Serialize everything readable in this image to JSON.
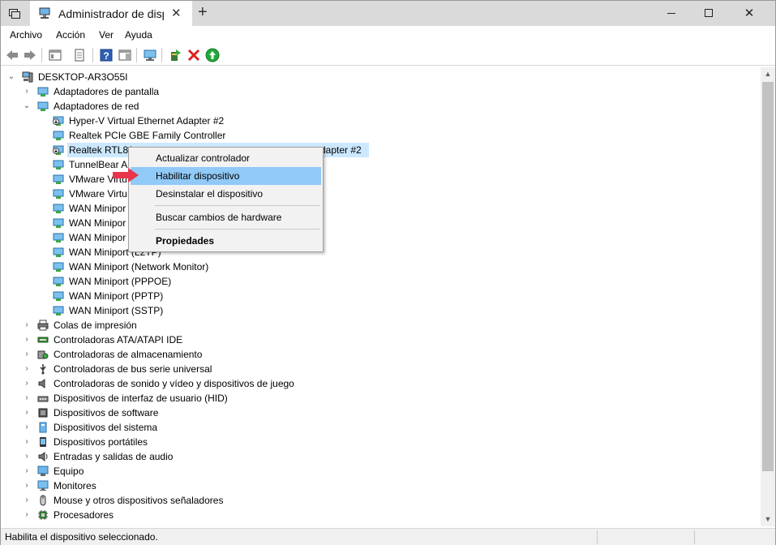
{
  "title_bar": {
    "tab_title": "Administrador de dispositivos",
    "close_tab": "✕",
    "new_tab": "+",
    "minimize_icon": "minimize-icon",
    "maximize_icon": "maximize-icon",
    "close_icon": "✕"
  },
  "menu": {
    "items": [
      "Archivo",
      "Acción",
      "Ver",
      "Ayuda"
    ]
  },
  "tree": {
    "root": "DESKTOP-AR3O55I",
    "display_adapters": "Adaptadores de pantalla",
    "network_adapters": "Adaptadores de red",
    "network_children": [
      "Hyper-V Virtual Ethernet Adapter #2",
      "Realtek PCIe GBE Family Controller",
      "Realtek RTL81",
      "TunnelBear A",
      "VMware Virtu",
      "VMware Virtu",
      "WAN Minipor",
      "WAN Minipor",
      "WAN Minipor",
      "WAN Miniport (L2TP)",
      "WAN Miniport (Network Monitor)",
      "WAN Miniport (PPPOE)",
      "WAN Miniport (PPTP)",
      "WAN Miniport (SSTP)"
    ],
    "selected_suffix": "dapter #2",
    "categories": [
      "Colas de impresión",
      "Controladoras ATA/ATAPI IDE",
      "Controladoras de almacenamiento",
      "Controladoras de bus serie universal",
      "Controladoras de sonido y vídeo y dispositivos de juego",
      "Dispositivos de interfaz de usuario (HID)",
      "Dispositivos de software",
      "Dispositivos del sistema",
      "Dispositivos portátiles",
      "Entradas y salidas de audio",
      "Equipo",
      "Monitores",
      "Mouse y otros dispositivos señaladores",
      "Procesadores"
    ]
  },
  "context_menu": {
    "update_driver": "Actualizar controlador",
    "enable_device": "Habilitar dispositivo",
    "uninstall_device": "Desinstalar el dispositivo",
    "scan_hardware": "Buscar cambios de hardware",
    "properties": "Propiedades"
  },
  "status_bar": {
    "text": "Habilita el dispositivo seleccionado."
  },
  "colors": {
    "selection": "#cce8ff",
    "menu_highlight": "#91c9f7",
    "arrow": "#e8354b",
    "titlebar": "#dadada"
  }
}
